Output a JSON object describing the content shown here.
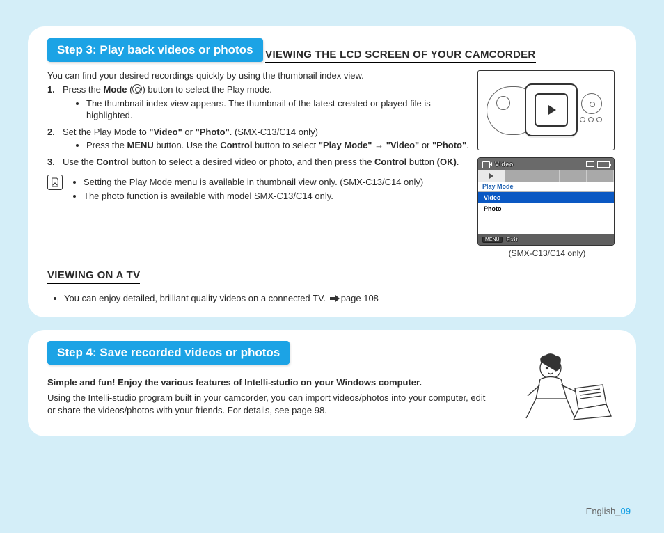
{
  "step3": {
    "header": "Step 3:   Play back videos or photos",
    "h_lcd": "VIEWING THE LCD SCREEN OF YOUR CAMCORDER",
    "intro": "You can find your desired recordings quickly by using the thumbnail index view.",
    "i1_pre": "Press the ",
    "i1_mode": "Mode",
    "i1_post": " button to select the Play mode.",
    "i1_b1": "The thumbnail index view appears. The thumbnail of the latest created or played file is highlighted.",
    "i2_pre1": "Set the Play Mode to ",
    "i2_q_video": "\"Video\"",
    "i2_or1": " or ",
    "i2_q_photo": "\"Photo\"",
    "i2_suffix": ". (SMX-C13/C14 only)",
    "i2_b_pre": "Press the ",
    "i2_b_menu": "MENU",
    "i2_b_mid1": " button. Use the ",
    "i2_b_ctrl": "Control",
    "i2_b_mid2": " button to select ",
    "i2_q_playmode": "\"Play Mode\"",
    "i2_arrow_sep": " → ",
    "i2_or2": " or ",
    "i2_end": ".",
    "i3_pre": "Use the ",
    "i3_ctrl": "Control",
    "i3_mid1": " button to select a desired video or photo, and then press the ",
    "i3_ctrl2": "Control",
    "i3_mid2": " button ",
    "i3_ok": "(OK)",
    "note1": "Setting the Play Mode menu is available in thumbnail view only. (SMX-C13/C14 only)",
    "note2": "The photo function is available with model SMX-C13/C14 only.",
    "h_tv": "VIEWING ON A TV",
    "tv_li_pre": "You can enjoy detailed, brilliant quality videos on a connected TV. ",
    "tv_li_page": "page 108",
    "lcd": {
      "title": "Video",
      "head": "Play Mode",
      "opt_video": "Video",
      "opt_photo": "Photo",
      "exit": "Exit",
      "menu_label": "MENU",
      "caption": "(SMX-C13/C14 only)"
    }
  },
  "step4": {
    "header": "Step 4:  Save recorded videos or photos",
    "bold_line": "Simple and fun! Enjoy the various features of Intelli-studio on your Windows computer.",
    "para": "Using the Intelli-studio program built in your camcorder, you can import videos/photos into your computer, edit or share the videos/photos with your friends. For details, see page 98."
  },
  "footer": {
    "lang": "English_",
    "page": "09"
  }
}
